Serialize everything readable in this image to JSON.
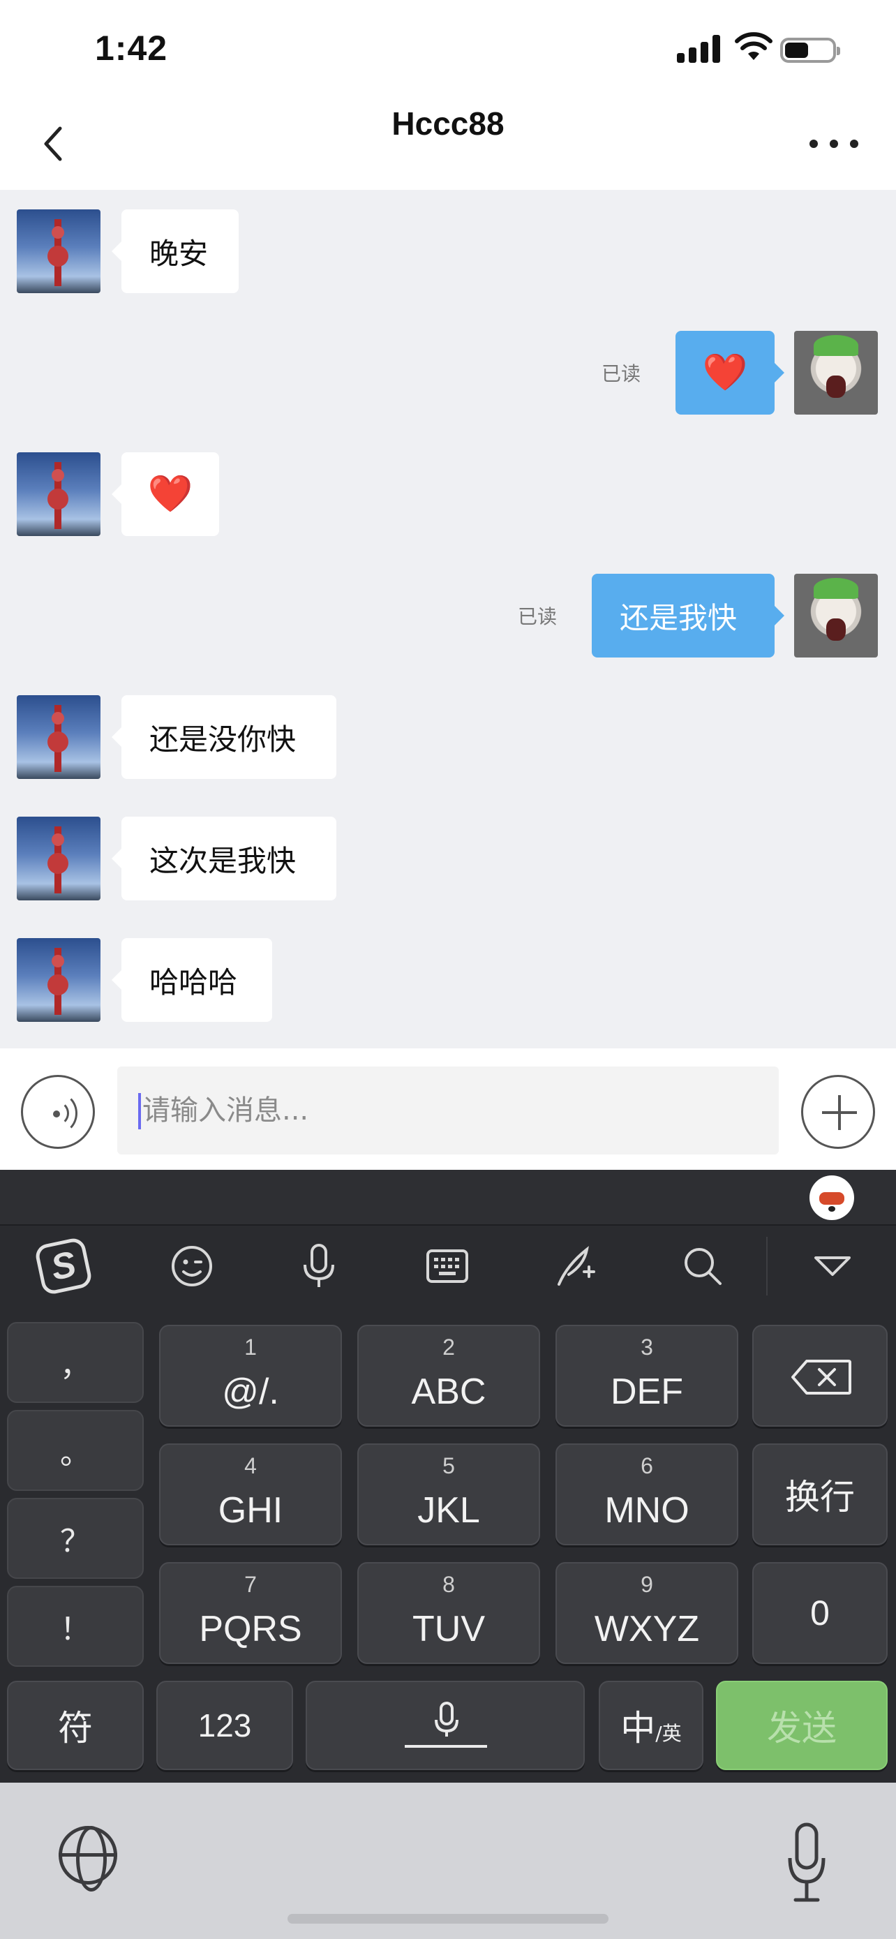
{
  "status_bar": {
    "time": "1:42",
    "battery_fraction": 0.5
  },
  "header": {
    "title": "Hccc88"
  },
  "messages": [
    {
      "side": "in",
      "text": "晚安"
    },
    {
      "side": "out",
      "text": "❤️",
      "status": "已读"
    },
    {
      "side": "in",
      "text": "❤️"
    },
    {
      "side": "out",
      "text": "还是我快",
      "status": "已读"
    },
    {
      "side": "in",
      "text": "还是没你快"
    },
    {
      "side": "in",
      "text": "这次是我快"
    },
    {
      "side": "in",
      "text": "哈哈哈"
    }
  ],
  "input": {
    "placeholder": "请输入消息..."
  },
  "keyboard": {
    "toolbar_icons": [
      "sogou-logo-icon",
      "emoji-icon",
      "microphone-icon",
      "keyboard-icon",
      "handwriting-icon",
      "search-icon",
      "collapse-icon"
    ],
    "sogou_logo": "S",
    "punctuation": [
      "，",
      "。",
      "？",
      "！"
    ],
    "keys": [
      {
        "num": "1",
        "letters": "@/."
      },
      {
        "num": "2",
        "letters": "ABC"
      },
      {
        "num": "3",
        "letters": "DEF"
      },
      {
        "num": "4",
        "letters": "GHI"
      },
      {
        "num": "5",
        "letters": "JKL"
      },
      {
        "num": "6",
        "letters": "MNO"
      },
      {
        "num": "7",
        "letters": "PQRS"
      },
      {
        "num": "8",
        "letters": "TUV"
      },
      {
        "num": "9",
        "letters": "WXYZ"
      }
    ],
    "newline": "换行",
    "zero": "0",
    "symbols": "符",
    "numbers": "123",
    "lang_main": "中",
    "lang_sub": "/英",
    "send": "发送"
  }
}
